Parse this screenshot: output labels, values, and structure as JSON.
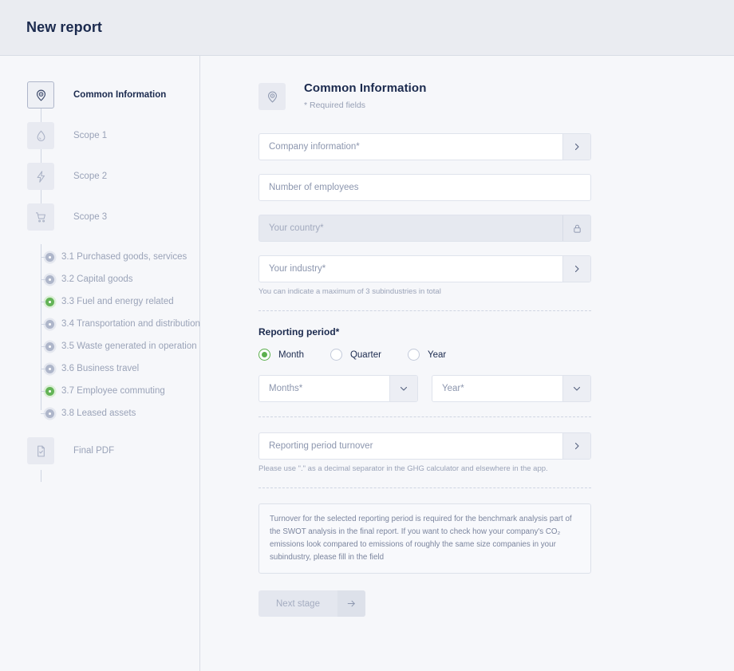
{
  "header": {
    "title": "New report"
  },
  "sidebar": {
    "steps": [
      {
        "label": "Common Information",
        "icon": "location-pin-icon",
        "active": true
      },
      {
        "label": "Scope 1",
        "icon": "droplet-icon",
        "active": false
      },
      {
        "label": "Scope 2",
        "icon": "lightning-bolt-icon",
        "active": false
      },
      {
        "label": "Scope 3",
        "icon": "shopping-cart-icon",
        "active": false
      }
    ],
    "substeps": [
      {
        "label": "3.1 Purchased goods, services",
        "done": false
      },
      {
        "label": "3.2 Capital goods",
        "done": false
      },
      {
        "label": "3.3 Fuel and energy related",
        "done": true
      },
      {
        "label": "3.4 Transportation and distribution",
        "done": false
      },
      {
        "label": "3.5 Waste generated in operation",
        "done": false
      },
      {
        "label": "3.6 Business travel",
        "done": false
      },
      {
        "label": "3.7 Employee commuting",
        "done": true
      },
      {
        "label": "3.8 Leased assets",
        "done": false
      }
    ],
    "final_step": {
      "label": "Final PDF",
      "icon": "document-check-icon"
    }
  },
  "main": {
    "section_title": "Common Information",
    "section_subtitle": "* Required fields",
    "fields": {
      "company_information": "Company information*",
      "number_of_employees": "Number of employees",
      "your_country": "Your country*",
      "your_industry": "Your industry*",
      "industry_hint": "You can indicate a maximum of 3 subindustries in total",
      "reporting_period_turnover": "Reporting period turnover",
      "turnover_hint": "Please use \".\" as a decimal separator in the GHG calculator and elsewhere in the app."
    },
    "reporting_period": {
      "title": "Reporting period*",
      "options": [
        {
          "label": "Month",
          "selected": true
        },
        {
          "label": "Quarter",
          "selected": false
        },
        {
          "label": "Year",
          "selected": false
        }
      ],
      "months_select": "Months*",
      "year_select": "Year*"
    },
    "infobox": "Turnover for the selected reporting period is required for the benchmark analysis part of the SWOT analysis in the final report. If you want to check how your company's CO₂ emissions look compared to emissions of roughly the same size companies in your subindustry, please fill in the field",
    "next_button": {
      "label": "Next stage",
      "icon": "arrow-right-icon"
    }
  },
  "colors": {
    "accent_green": "#5cb04e",
    "text_dark": "#1b2a4e",
    "text_muted": "#9aa3b8",
    "header_bg": "#eaecf1",
    "page_bg": "#f6f7fa"
  }
}
